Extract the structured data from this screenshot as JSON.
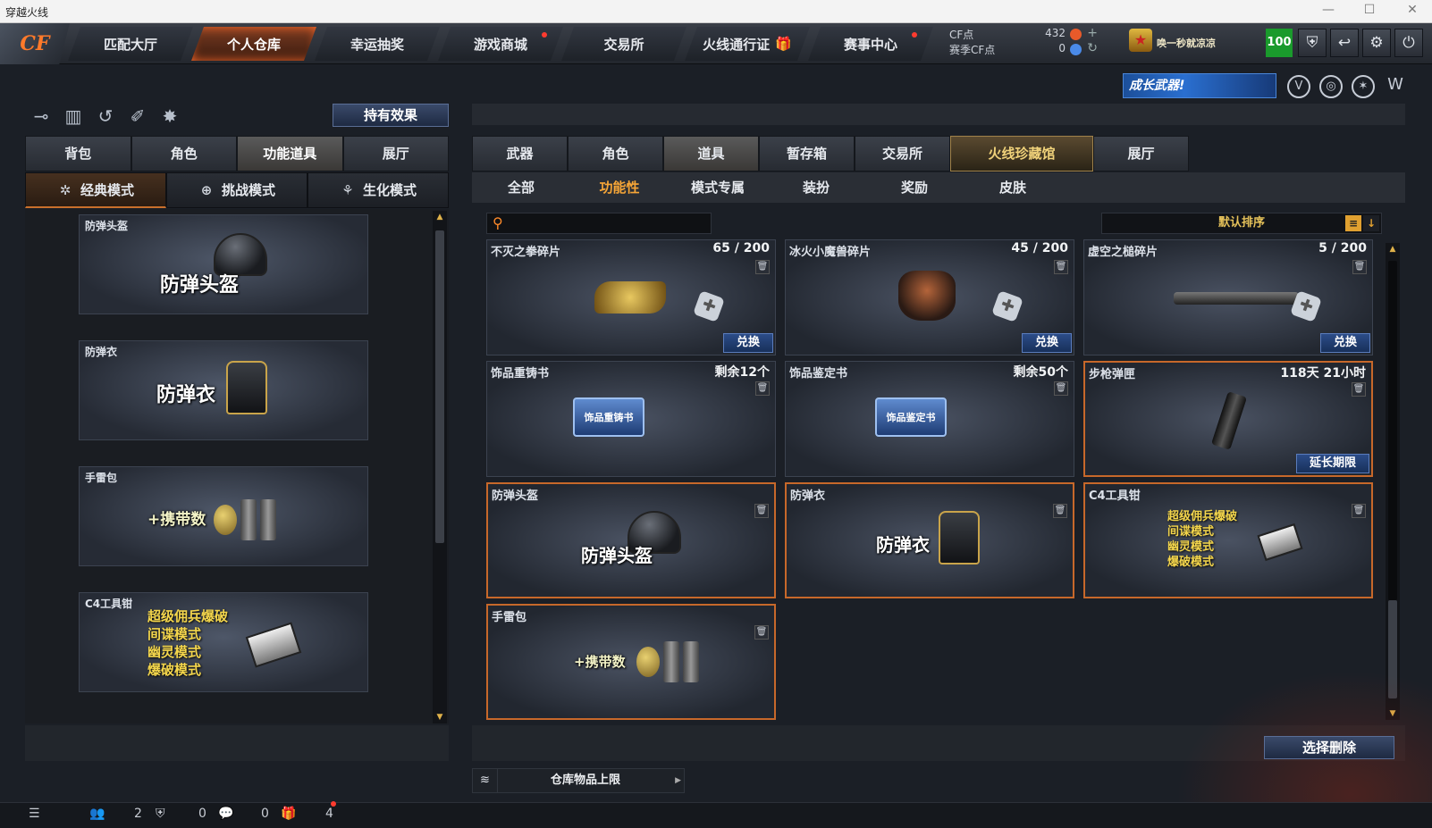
{
  "window": {
    "title": "穿越火线"
  },
  "nav": {
    "tabs": [
      {
        "label": "匹配大厅",
        "active": false,
        "dot": false
      },
      {
        "label": "个人仓库",
        "active": true,
        "dot": false
      },
      {
        "label": "幸运抽奖",
        "active": false,
        "dot": false
      },
      {
        "label": "游戏商城",
        "active": false,
        "dot": true
      },
      {
        "label": "交易所",
        "active": false,
        "dot": false
      },
      {
        "label": "火线通行证",
        "active": false,
        "dot": false
      },
      {
        "label": "赛事中心",
        "active": false,
        "dot": true
      }
    ],
    "logo": "CF"
  },
  "account": {
    "cf_label": "CF点",
    "cf_value": "432",
    "season_label": "赛季CF点",
    "season_value": "0",
    "username": "唤一秒就凉凉",
    "level": "100"
  },
  "banner": {
    "text": "成长武器!"
  },
  "left": {
    "effect_button": "持有效果",
    "tabs": [
      "背包",
      "角色",
      "功能道具",
      "展厅"
    ],
    "modes": [
      "经典模式",
      "挑战模式",
      "生化模式"
    ],
    "cards": [
      {
        "name": "防弹头盔",
        "art_text": "防弹头盔"
      },
      {
        "name": "防弹衣",
        "art_text": "防弹衣"
      },
      {
        "name": "手雷包",
        "art_text": "+携带数"
      },
      {
        "name": "C4工具钳",
        "lines": [
          "超级佣兵爆破",
          "间谍模式",
          "幽灵模式",
          "爆破模式"
        ]
      }
    ]
  },
  "right": {
    "tabs": [
      "武器",
      "角色",
      "道具",
      "暂存箱",
      "交易所",
      "火线珍藏馆",
      "展厅"
    ],
    "subtabs": [
      "全部",
      "功能性",
      "模式专属",
      "装扮",
      "奖励",
      "皮肤"
    ],
    "sort": "默认排序",
    "items": [
      {
        "name": "不灭之拳碎片",
        "count": "65 / 200",
        "action": "兑换"
      },
      {
        "name": "冰火小魔兽碎片",
        "count": "45 / 200",
        "action": "兑换"
      },
      {
        "name": "虚空之槌碎片",
        "count": "5 / 200",
        "action": "兑换"
      },
      {
        "name": "饰品重铸书",
        "count": "剩余12个",
        "art": "饰品重铸书"
      },
      {
        "name": "饰品鉴定书",
        "count": "剩余50个",
        "art": "饰品鉴定书"
      },
      {
        "name": "步枪弹匣",
        "count": "118天 21小时",
        "action": "延长期限"
      },
      {
        "name": "防弹头盔",
        "art_text": "防弹头盔"
      },
      {
        "name": "防弹衣",
        "art_text": "防弹衣"
      },
      {
        "name": "C4工具钳",
        "lines": [
          "超级佣兵爆破",
          "间谍模式",
          "幽灵模式",
          "爆破模式"
        ]
      },
      {
        "name": "手雷包",
        "art_text": "+携带数"
      }
    ],
    "select_delete": "选择删除",
    "capacity": "仓库物品上限"
  },
  "status": {
    "friends": "2",
    "messages": "0",
    "gifts": "0",
    "notices": "4"
  }
}
